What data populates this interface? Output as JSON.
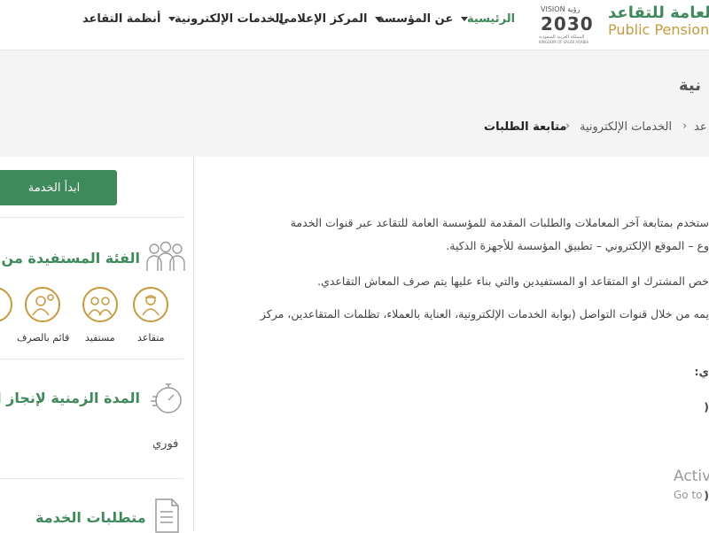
{
  "header": {
    "logo_ar": "العامة للتقاعد",
    "logo_en": "Public Pension",
    "vision_top": "VISION رؤية",
    "vision_year": "2030",
    "vision_sub": "المملكة العربية السعودية",
    "vision_sub_en": "KINGDOM OF SAUDI ARABIA",
    "nav": {
      "home": "الرئيسية",
      "about": "عن المؤسسة",
      "media": "المركز الإعلامي",
      "eservices": "الخدمات الإلكترونية",
      "systems": "أنظمة التقاعد"
    }
  },
  "band": {
    "title": "نية",
    "breadcrumb": {
      "first": "عد",
      "eservices": "الخدمات الإلكترونية",
      "current": "متابعة الطلبات",
      "sep": "›"
    }
  },
  "sidebar": {
    "start_button": "ابدأ الخدمة",
    "beneficiary_heading": "الفئة المستفيدة من ا",
    "categories": {
      "retiree": "متقاعد",
      "beneficiary": "مستفيد",
      "payee": "قائم بالصرف"
    },
    "duration_heading": "المدة الزمنية لإنجاز ال",
    "duration_value": "فوري",
    "requirements_heading": "متطلبات الخدمة"
  },
  "main": {
    "line1": "ستخدم بمتابعة آخر المعاملات والطلبات المقدمة للمؤسسة العامة للتقاعد عبر قنوات الخدمة",
    "line2": "وع – الموقع الإلكتروني – تطبيق المؤسسة للأجهزة الذكية.",
    "line3": "خص المشترك او المتقاعد او المستفيدين والتي بناء عليها يتم صرف المعاش التقاعدي.",
    "line4": "يمه من خلال قنوات التواصل (بوابة الخدمات الإلكترونية، العناية بالعملاء، تظلمات المتقاعدين، مركز",
    "frag1": "ي:",
    "frag2": "(",
    "frag3": "("
  },
  "watermark": {
    "line1": "Activ",
    "line2": "Go to"
  },
  "colors": {
    "brand_green": "#3e8a5a",
    "brand_gold": "#c89a3c"
  }
}
